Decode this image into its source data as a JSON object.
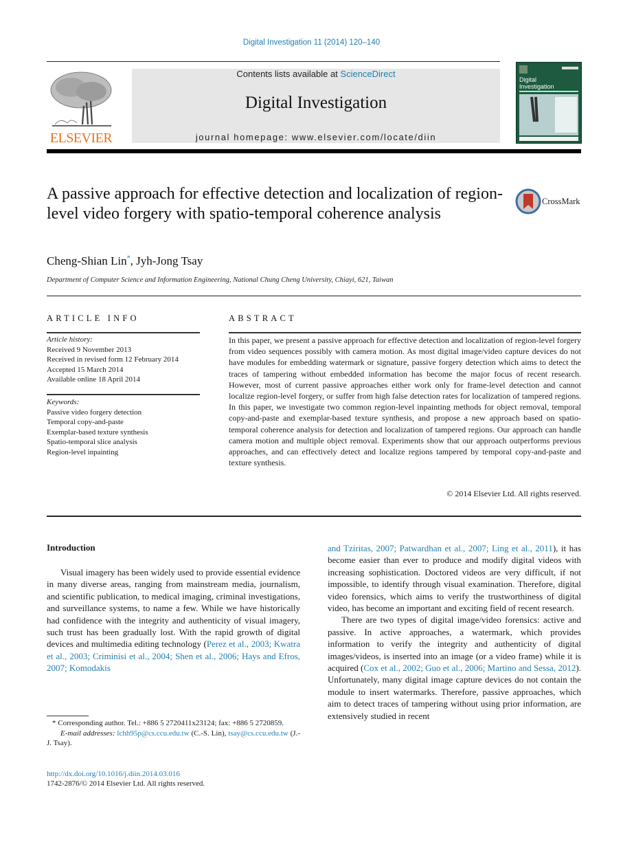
{
  "header": {
    "running_head": "Digital Investigation 11 (2014) 120–140",
    "contents_prefix": "Contents lists available at ",
    "contents_link": "ScienceDirect",
    "journal_name": "Digital Investigation",
    "homepage": "journal homepage: www.elsevier.com/locate/diin",
    "publisher_logo_text": "ELSEVIER",
    "cover_title": "Digital Investigation",
    "colors": {
      "link": "#1f7fb0",
      "elsevier_orange": "#e8731c",
      "cover_green": "#1d5a3f",
      "masthead_bg": "#e6e6e6"
    }
  },
  "article": {
    "title": "A passive approach for effective detection and localization of region-level video forgery with spatio-temporal coherence analysis",
    "crossmark_label": "CrossMark",
    "authors": [
      {
        "name": "Cheng-Shian Lin",
        "mark": "*"
      },
      {
        "name": "Jyh-Jong Tsay",
        "mark": ""
      }
    ],
    "author_separator": ", ",
    "affiliation": "Department of Computer Science and Information Engineering, National Chung Cheng University, Chiayi, 621, Taiwan"
  },
  "article_info": {
    "heading": "ARTICLE INFO",
    "history_label": "Article history:",
    "history": [
      "Received 9 November 2013",
      "Received in revised form 12 February 2014",
      "Accepted 15 March 2014",
      "Available online 18 April 2014"
    ],
    "keywords_label": "Keywords:",
    "keywords": [
      "Passive video forgery detection",
      "Temporal copy-and-paste",
      "Exemplar-based texture synthesis",
      "Spatio-temporal slice analysis",
      "Region-level inpainting"
    ]
  },
  "abstract": {
    "heading": "ABSTRACT",
    "text": "In this paper, we present a passive approach for effective detection and localization of region-level forgery from video sequences possibly with camera motion. As most digital image/video capture devices do not have modules for embedding watermark or signature, passive forgery detection which aims to detect the traces of tampering without embedded information has become the major focus of recent research. However, most of current passive approaches either work only for frame-level detection and cannot localize region-level forgery, or suffer from high false detection rates for localization of tampered regions. In this paper, we investigate two common region-level inpainting methods for object removal, temporal copy-and-paste and exemplar-based texture synthesis, and propose a new approach based on spatio-temporal coherence analysis for detection and localization of tampered regions. Our approach can handle camera motion and multiple object removal. Experiments show that our approach outperforms previous approaches, and can effectively detect and localize regions tampered by temporal copy-and-paste and texture synthesis.",
    "copyright": "© 2014 Elsevier Ltd. All rights reserved."
  },
  "introduction": {
    "heading": "Introduction",
    "p1_text": "Visual imagery has been widely used to provide essential evidence in many diverse areas, ranging from mainstream media, journalism, and scientific publication, to medical imaging, criminal investigations, and surveillance systems, to name a few. While we have historically had confidence with the integrity and authenticity of visual imagery, such trust has been gradually lost. With the rapid growth of digital devices and multimedia editing technology (",
    "p1_cites": "Perez et al., 2003; Kwatra et al., 2003; Criminisi et al., 2004; Shen et al., 2006; Hays and Efros, 2007; Komodakis and Tziritas, 2007; Patwardhan et al., 2007; Ling et al., 2011",
    "p1_tail": "), it has become easier than ever to produce and modify digital videos with increasing sophistication. Doctored videos are very difficult, if not impossible, to identify through visual examination. Therefore, digital video forensics, which aims to verify the trustworthiness of digital video, has become an important and exciting field of recent research.",
    "p2_text": "There are two types of digital image/video forensics: active and passive. In active approaches, a watermark, which provides information to verify the integrity and authenticity of digital images/videos, is inserted into an image (or a video frame) while it is acquired (",
    "p2_cites": "Cox et al., 2002; Guo et al., 2006; Martino and Sessa, 2012",
    "p2_tail": "). Unfortunately, many digital image capture devices do not contain the module to insert watermarks. Therefore, passive approaches, which aim to detect traces of tampering without using prior information, are extensively studied in recent"
  },
  "footnotes": {
    "corresponding": "* Corresponding author. Tel.: +886 5 2720411x23124; fax: +886 5 2720859.",
    "email_label": "E-mail addresses: ",
    "email1": "lchh95p@cs.ccu.edu.tw",
    "email1_owner": " (C.-S. Lin), ",
    "email2": "tsay@cs.ccu.edu.tw",
    "email2_owner": " (J.-J. Tsay).",
    "doi": "http://dx.doi.org/10.1016/j.diin.2014.03.016",
    "issn": "1742-2876/© 2014 Elsevier Ltd. All rights reserved."
  }
}
